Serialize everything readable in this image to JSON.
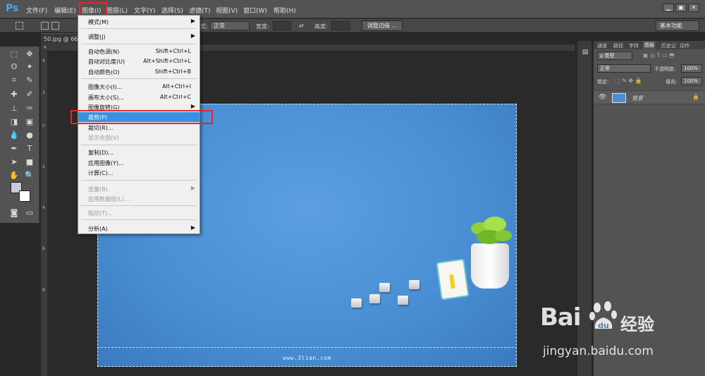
{
  "app": {
    "logo": "Ps"
  },
  "menubar": {
    "items": [
      "文件(F)",
      "编辑(E)",
      "图像(I)",
      "图层(L)",
      "文字(Y)",
      "选择(S)",
      "滤镜(T)",
      "视图(V)",
      "窗口(W)",
      "帮助(H)"
    ],
    "window_buttons": [
      "▁",
      "▣",
      "✕"
    ]
  },
  "optionsbar": {
    "style_label": "式:",
    "style_value": "正常",
    "width_label": "宽度:",
    "height_label": "高度:",
    "refine_edge": "调整边缘 ...",
    "workspace": "基本功能"
  },
  "document": {
    "tab_title": "50.jpg @ 66",
    "ruler_numbers": [
      "4",
      "2",
      "0",
      "2",
      "4",
      "6",
      "8"
    ]
  },
  "image": {
    "site_text": "www.3lian.com"
  },
  "image_menu": {
    "items": [
      {
        "label": "模式(M)",
        "shortcut": "",
        "submenu": true,
        "disabled": false
      },
      {
        "label": "调整(J)",
        "shortcut": "",
        "submenu": true,
        "disabled": false
      },
      {
        "label": "自动色调(N)",
        "shortcut": "Shift+Ctrl+L",
        "submenu": false,
        "disabled": false
      },
      {
        "label": "自动对比度(U)",
        "shortcut": "Alt+Shift+Ctrl+L",
        "submenu": false,
        "disabled": false
      },
      {
        "label": "自动颜色(O)",
        "shortcut": "Shift+Ctrl+B",
        "submenu": false,
        "disabled": false
      },
      {
        "label": "图像大小(I)...",
        "shortcut": "Alt+Ctrl+I",
        "submenu": false,
        "disabled": false
      },
      {
        "label": "画布大小(S)...",
        "shortcut": "Alt+Ctrl+C",
        "submenu": false,
        "disabled": false
      },
      {
        "label": "图像旋转(G)",
        "shortcut": "",
        "submenu": true,
        "disabled": false
      },
      {
        "label": "裁剪(P)",
        "shortcut": "",
        "submenu": false,
        "disabled": false,
        "active": true
      },
      {
        "label": "裁切(R)...",
        "shortcut": "",
        "submenu": false,
        "disabled": false
      },
      {
        "label": "显示全部(V)",
        "shortcut": "",
        "submenu": false,
        "disabled": true
      },
      {
        "label": "复制(D)...",
        "shortcut": "",
        "submenu": false,
        "disabled": false
      },
      {
        "label": "应用图像(Y)...",
        "shortcut": "",
        "submenu": false,
        "disabled": false
      },
      {
        "label": "计算(C)...",
        "shortcut": "",
        "submenu": false,
        "disabled": false
      },
      {
        "label": "变量(B)",
        "shortcut": "",
        "submenu": true,
        "disabled": true
      },
      {
        "label": "应用数据组(L)...",
        "shortcut": "",
        "submenu": false,
        "disabled": true
      },
      {
        "label": "陷印(T)...",
        "shortcut": "",
        "submenu": false,
        "disabled": true
      },
      {
        "label": "分析(A)",
        "shortcut": "",
        "submenu": true,
        "disabled": false
      }
    ]
  },
  "layers_panel": {
    "tabs": [
      "通道",
      "路径",
      "字符",
      "图层",
      "历史记",
      "动作"
    ],
    "filter_label": "ρ 类型",
    "blend_mode": "正常",
    "opacity_label": "不透明度:",
    "opacity_value": "100%",
    "lock_label": "锁定:",
    "fill_label": "填充:",
    "fill_value": "100%",
    "layer_name": "背景"
  },
  "watermark": {
    "logo_text": "Bai",
    "logo_suffix": "du",
    "jingyan": "经验",
    "url": "jingyan.baidu.com"
  }
}
